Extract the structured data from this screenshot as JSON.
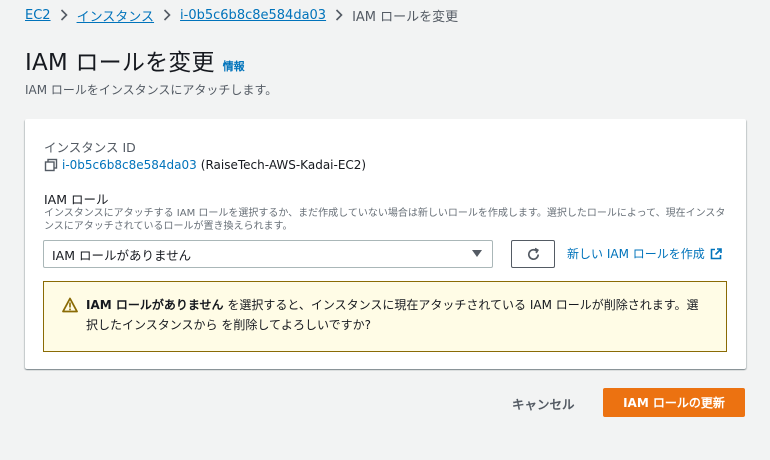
{
  "breadcrumb": {
    "items": [
      "EC2",
      "インスタンス",
      "i-0b5c6b8c8e584da03"
    ],
    "current": "IAM ロールを変更"
  },
  "header": {
    "title": "IAM ロールを変更",
    "info_link": "情報",
    "description": "IAM ロールをインスタンスにアタッチします。"
  },
  "form": {
    "instance_label": "インスタンス ID",
    "instance_id": "i-0b5c6b8c8e584da03",
    "instance_name": "(RaiseTech-AWS-Kadai-EC2)",
    "role_label": "IAM ロール",
    "role_description": "インスタンスにアタッチする IAM ロールを選択するか、まだ作成していない場合は新しいロールを作成します。選択したロールによって、現在インスタンスにアタッチされているロールが置き換えられます。",
    "role_select_value": "IAM ロールがありません",
    "create_role_link": "新しい IAM ロールを作成"
  },
  "alert": {
    "bold_text": "IAM ロールがありません",
    "text": " を選択すると、インスタンスに現在アタッチされている IAM ロールが削除されます。選択したインスタンスから を削除してよろしいですか?"
  },
  "footer": {
    "cancel_label": "キャンセル",
    "submit_label": "IAM ロールの更新"
  },
  "colors": {
    "link": "#0073bb",
    "primary": "#ec7211",
    "alert_bg": "#fffce6",
    "alert_border": "#8a6b05",
    "page_bg": "#f2f3f3"
  }
}
